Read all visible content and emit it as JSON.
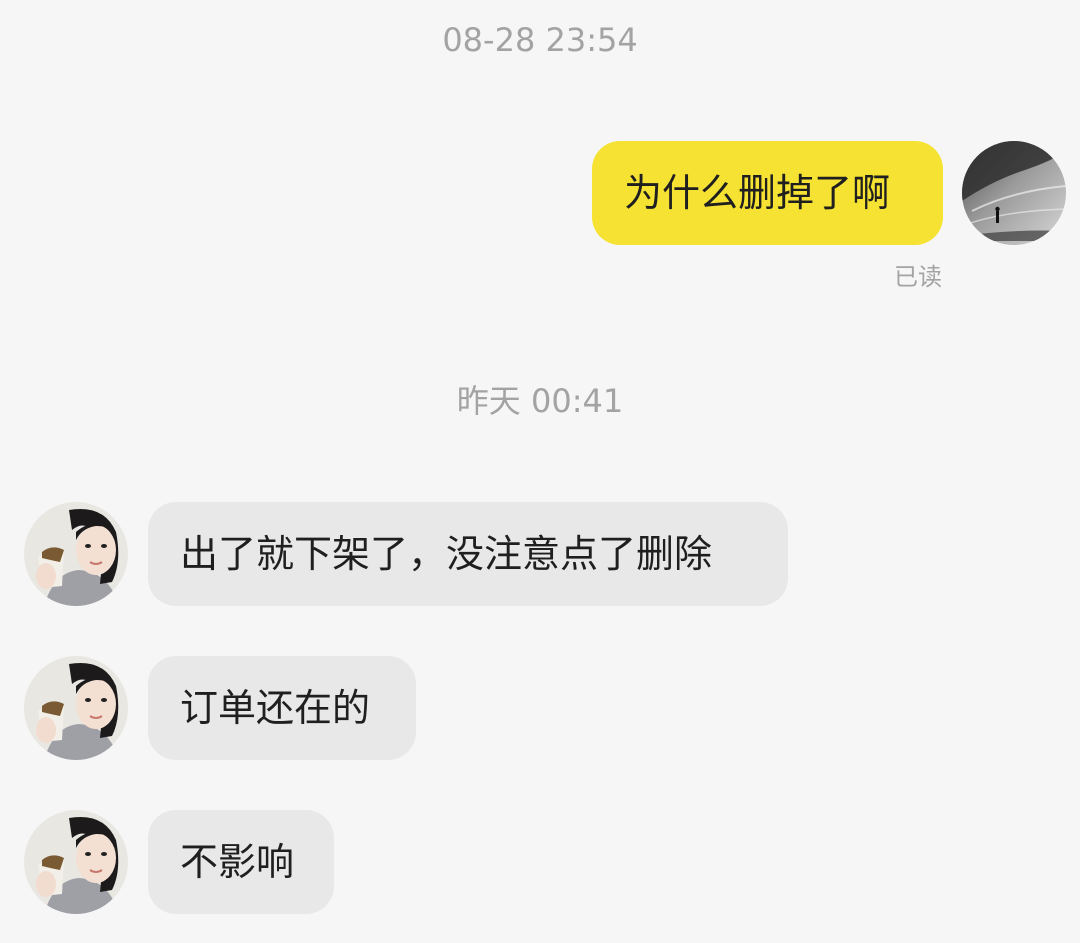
{
  "conversation": {
    "timestamps": [
      "08-28 23:54",
      "昨天 00:41"
    ],
    "sent_messages": [
      {
        "text": "为什么删掉了啊",
        "status": "已读"
      }
    ],
    "received_messages": [
      {
        "text": "出了就下架了，没注意点了删除"
      },
      {
        "text": "订单还在的"
      },
      {
        "text": "不影响"
      }
    ]
  },
  "colors": {
    "background": "#f6f6f6",
    "sent_bubble": "#f5e232",
    "received_bubble": "#e8e8e8",
    "timestamp_text": "#a3a3a3",
    "message_text": "#1f1f1f"
  },
  "icons": {
    "self_avatar": "beach-photo-avatar",
    "contact_avatar": "girl-portrait-avatar"
  }
}
